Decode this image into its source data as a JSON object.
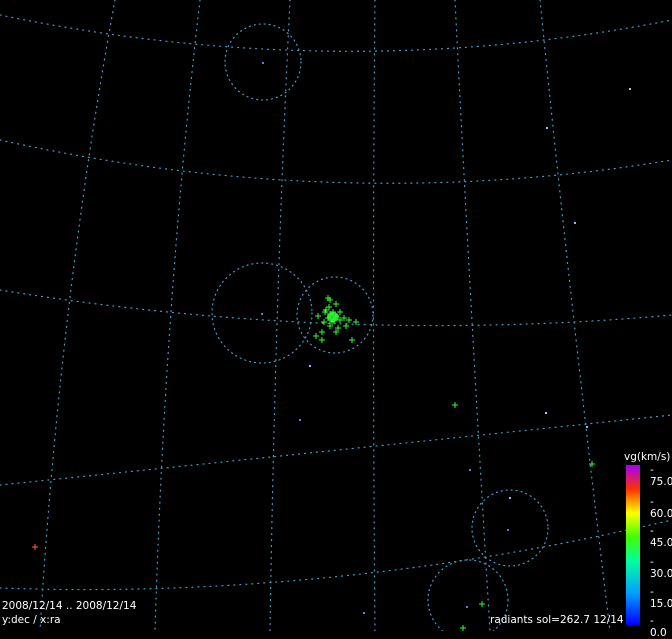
{
  "footer": {
    "date_range": "2008/12/14 .. 2008/12/14",
    "axes": "y:dec / x:ra",
    "radiants": "radiants sol=262.7 12/14"
  },
  "chart_data": {
    "type": "scatter",
    "title": "radiants sol=262.7 12/14",
    "xlabel": "ra",
    "ylabel": "dec",
    "colorbar": {
      "label": "vg(km/s)",
      "range": [
        0.0,
        75.0
      ],
      "ticks": [
        "75.0",
        "60.0",
        "45.0",
        "30.0",
        "15.0",
        "0.0"
      ]
    },
    "series": [
      {
        "name": "radiants",
        "color_by": "vg",
        "points": [
          {
            "id": "r1",
            "vg": 35
          },
          {
            "id": "r2",
            "vg": 35
          },
          {
            "id": "r3",
            "vg": 35
          },
          {
            "id": "r4",
            "vg": 35
          },
          {
            "id": "r5",
            "vg": 35
          },
          {
            "id": "r6",
            "vg": 35
          },
          {
            "id": "r7",
            "vg": 35
          },
          {
            "id": "r8",
            "vg": 35
          },
          {
            "id": "r9",
            "vg": 35
          },
          {
            "id": "r10",
            "vg": 35
          },
          {
            "id": "r11",
            "vg": 35
          },
          {
            "id": "r12",
            "vg": 35
          },
          {
            "id": "r13",
            "vg": 35
          },
          {
            "id": "r14",
            "vg": 35
          },
          {
            "id": "r15",
            "vg": 35
          },
          {
            "id": "r16",
            "vg": 35
          },
          {
            "id": "r17",
            "vg": 35
          },
          {
            "id": "r18",
            "vg": 35
          },
          {
            "id": "r19",
            "vg": 35
          },
          {
            "id": "r20",
            "vg": 35
          },
          {
            "id": "r21",
            "vg": 35
          },
          {
            "id": "r22",
            "vg": 35
          },
          {
            "id": "r23",
            "vg": 35
          },
          {
            "id": "r24",
            "vg": 35
          },
          {
            "id": "r25",
            "vg": 35
          },
          {
            "id": "r26",
            "vg": 35
          },
          {
            "id": "r27",
            "vg": 38
          },
          {
            "id": "r28",
            "vg": 38
          },
          {
            "id": "r29",
            "vg": 38
          },
          {
            "id": "r30",
            "vg": 38
          },
          {
            "id": "r31",
            "vg": 38
          },
          {
            "id": "r32",
            "vg": 65
          }
        ]
      }
    ]
  }
}
